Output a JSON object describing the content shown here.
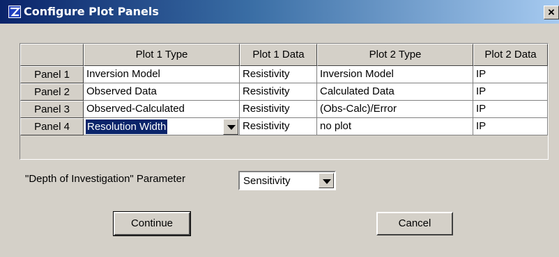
{
  "window": {
    "title": "Configure Plot Panels",
    "close_label": "×"
  },
  "table": {
    "headers": [
      "",
      "Plot 1 Type",
      "Plot 1 Data",
      "Plot 2 Type",
      "Plot 2 Data"
    ],
    "rows": [
      {
        "panel": "Panel 1",
        "plot1_type": "Inversion Model",
        "plot1_data": "Resistivity",
        "plot2_type": "Inversion Model",
        "plot2_data": "IP"
      },
      {
        "panel": "Panel 2",
        "plot1_type": "Observed Data",
        "plot1_data": "Resistivity",
        "plot2_type": "Calculated Data",
        "plot2_data": "IP"
      },
      {
        "panel": "Panel 3",
        "plot1_type": "Observed-Calculated",
        "plot1_data": "Resistivity",
        "plot2_type": "(Obs-Calc)/Error",
        "plot2_data": "IP"
      },
      {
        "panel": "Panel 4",
        "plot1_type": "Resolution Width",
        "plot1_data": "Resistivity",
        "plot2_type": "no plot",
        "plot2_data": "IP"
      }
    ]
  },
  "doi": {
    "label": "\"Depth of Investigation\" Parameter",
    "value": "Sensitivity"
  },
  "buttons": {
    "continue": "Continue",
    "cancel": "Cancel"
  },
  "colors": {
    "titlebar_start": "#0a246a",
    "titlebar_end": "#a6caf0",
    "selection": "#0a246a",
    "face": "#d4d0c8"
  }
}
